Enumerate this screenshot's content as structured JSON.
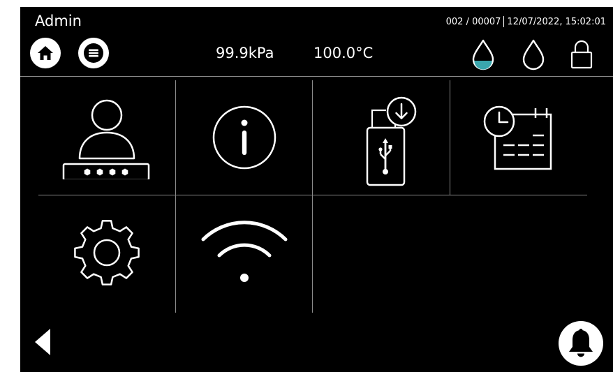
{
  "header": {
    "user": "Admin",
    "counter": "002 / 00007",
    "datetime": "12/07/2022, 15:02:01",
    "pressure": "99.9kPa",
    "temperature": "100.0°C"
  },
  "nav": {
    "home_icon": "home-icon",
    "menu_icon": "menu-icon"
  },
  "status_icons": [
    "water-drop-filled-icon",
    "water-drop-empty-icon",
    "lock-icon"
  ],
  "tiles": [
    {
      "icon": "user-password-icon"
    },
    {
      "icon": "info-icon"
    },
    {
      "icon": "usb-download-icon"
    },
    {
      "icon": "schedule-calendar-icon"
    },
    {
      "icon": "gear-icon"
    },
    {
      "icon": "wifi-icon"
    }
  ],
  "footer": {
    "back_icon": "back-arrow-icon",
    "alarm_icon": "bell-icon"
  },
  "colors": {
    "background": "#000000",
    "foreground": "#ffffff",
    "accent_teal": "#3aa6ad",
    "divider": "#8a8a8a"
  }
}
